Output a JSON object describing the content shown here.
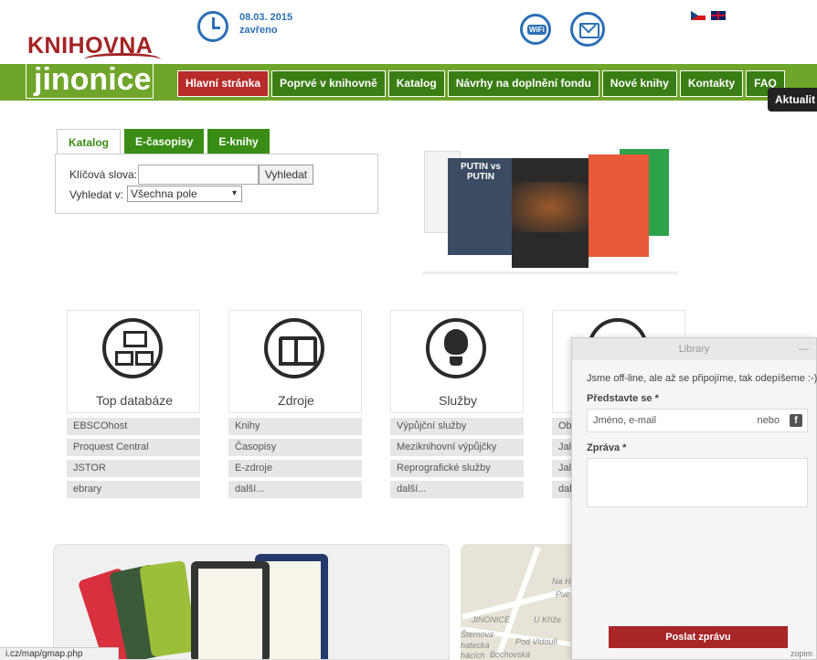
{
  "header": {
    "logo_top": "KNIHOVNA",
    "logo_bottom": "jinonice",
    "date": "08.03. 2015",
    "status": "zavřeno"
  },
  "nav": {
    "items": [
      {
        "label": "Hlavní stránka",
        "active": true
      },
      {
        "label": "Poprvé v knihovně",
        "active": false
      },
      {
        "label": "Katalog",
        "active": false
      },
      {
        "label": "Návrhy na doplnění fondu",
        "active": false
      },
      {
        "label": "Nové knihy",
        "active": false
      },
      {
        "label": "Kontakty",
        "active": false
      },
      {
        "label": "FAQ",
        "active": false
      }
    ],
    "aktuality": "Aktualit"
  },
  "search": {
    "tabs": [
      "Katalog",
      "E-časopisy",
      "E-knihy"
    ],
    "keyword_label": "Klíčová slova:",
    "search_button": "Vyhledat",
    "field_label": "Vyhledat v:",
    "field_selected": "Všechna pole"
  },
  "books": {
    "b2_title": "PUTIN vs PUTIN"
  },
  "categories": [
    {
      "title": "Top databáze",
      "items": [
        "EBSCOhost",
        "Proquest Central",
        "JSTOR",
        "ebrary"
      ]
    },
    {
      "title": "Zdroje",
      "items": [
        "Knihy",
        "Časopisy",
        "E-zdroje",
        "další..."
      ]
    },
    {
      "title": "Služby",
      "items": [
        "Výpůjční služby",
        "Meziknihovní výpůjčky",
        "Reprografické služby",
        "další..."
      ]
    },
    {
      "title": "",
      "items": [
        "Ob",
        "Jal",
        "Jal",
        "dal"
      ]
    }
  ],
  "map": {
    "labels": [
      "Na Hř",
      "Puc",
      "JINONICE",
      "U Kříže",
      "Šternova",
      "Bochovská",
      "Pod Vidoulí",
      "hatecká",
      "hácích"
    ]
  },
  "statusbar": "i.cz/map/gmap.php",
  "chat": {
    "header": "Library",
    "minimize": "—",
    "message": "Jsme off-line, ale až se připojíme, tak odepíšeme :-)",
    "name_label": "Představte se *",
    "name_placeholder": "Jméno, e-mail",
    "or_label": "nebo",
    "message_label": "Zpráva *",
    "send_button": "Poslat zprávu",
    "brand": "zopim"
  }
}
